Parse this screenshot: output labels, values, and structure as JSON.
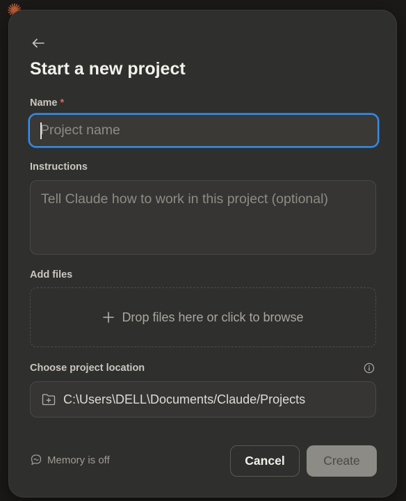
{
  "modal": {
    "title": "Start a new project"
  },
  "name_field": {
    "label": "Name",
    "required_mark": "*",
    "placeholder": "Project name",
    "value": ""
  },
  "instructions_field": {
    "label": "Instructions",
    "placeholder": "Tell Claude how to work in this project (optional)",
    "value": ""
  },
  "files": {
    "label": "Add files",
    "dropzone_text": "Drop files here or click to browse"
  },
  "location": {
    "label": "Choose project location",
    "path": "C:\\Users\\DELL\\Documents/Claude/Projects"
  },
  "memory": {
    "status_text": "Memory is off"
  },
  "actions": {
    "cancel_label": "Cancel",
    "create_label": "Create"
  },
  "icons": {
    "back": "arrow-left-icon",
    "add": "plus-icon",
    "info": "info-icon",
    "folder": "folder-plus-icon",
    "memory": "memory-chat-icon"
  },
  "colors": {
    "focus_ring": "#3a8ee6",
    "required": "#e0645a",
    "modal_bg": "#2f2f2d",
    "create_disabled_bg": "#8c8b85"
  }
}
